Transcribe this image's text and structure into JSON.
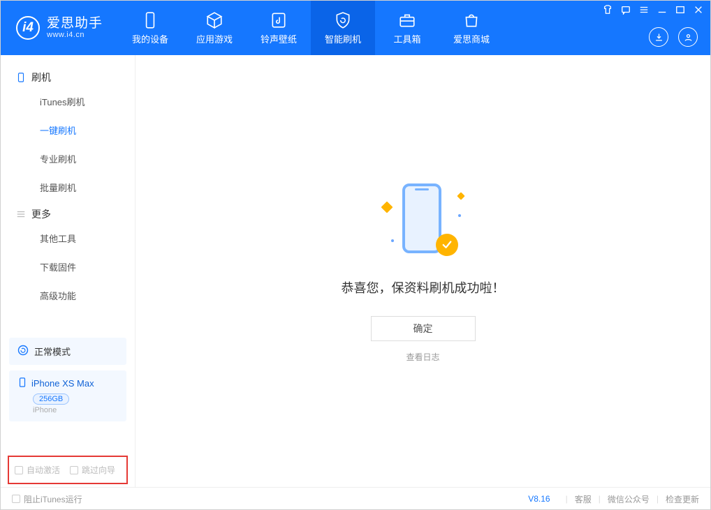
{
  "app": {
    "name_cn": "爱思助手",
    "name_en": "www.i4.cn"
  },
  "nav": {
    "items": [
      {
        "id": "device",
        "label": "我的设备"
      },
      {
        "id": "apps",
        "label": "应用游戏"
      },
      {
        "id": "ring",
        "label": "铃声壁纸"
      },
      {
        "id": "flash",
        "label": "智能刷机"
      },
      {
        "id": "toolbox",
        "label": "工具箱"
      },
      {
        "id": "store",
        "label": "爱思商城"
      }
    ]
  },
  "sidebar": {
    "group_flash": "刷机",
    "items_flash": [
      "iTunes刷机",
      "一键刷机",
      "专业刷机",
      "批量刷机"
    ],
    "group_more": "更多",
    "items_more": [
      "其他工具",
      "下载固件",
      "高级功能"
    ],
    "mode": "正常模式",
    "device": {
      "name": "iPhone XS Max",
      "capacity": "256GB",
      "type": "iPhone"
    },
    "auto_activate": "自动激活",
    "skip_guide": "跳过向导"
  },
  "main": {
    "success_msg": "恭喜您，保资料刷机成功啦！",
    "ok": "确定",
    "view_log": "查看日志"
  },
  "footer": {
    "block_itunes": "阻止iTunes运行",
    "version": "V8.16",
    "links": [
      "客服",
      "微信公众号",
      "检查更新"
    ]
  }
}
